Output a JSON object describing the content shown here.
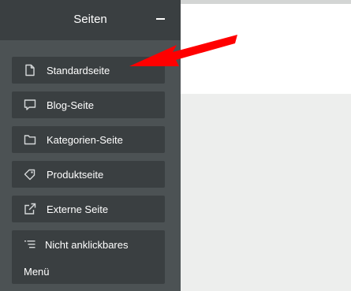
{
  "sidebar": {
    "title": "Seiten",
    "items": [
      {
        "label": "Standardseite",
        "icon": "page-icon"
      },
      {
        "label": "Blog-Seite",
        "icon": "comment-icon"
      },
      {
        "label": "Kategorien-Seite",
        "icon": "folder-icon"
      },
      {
        "label": "Produktseite",
        "icon": "tag-icon"
      },
      {
        "label": "Externe Seite",
        "icon": "external-link-icon"
      },
      {
        "label": "Nicht anklickbares",
        "label_line2": "Menü",
        "icon": "list-icon"
      }
    ]
  },
  "annotation": {
    "color": "#ff0000",
    "points_to": "Standardseite"
  },
  "colors": {
    "sidebar": "#4c5254",
    "item": "#3a3f41",
    "content": "#ffffff",
    "background": "#edeeed"
  }
}
